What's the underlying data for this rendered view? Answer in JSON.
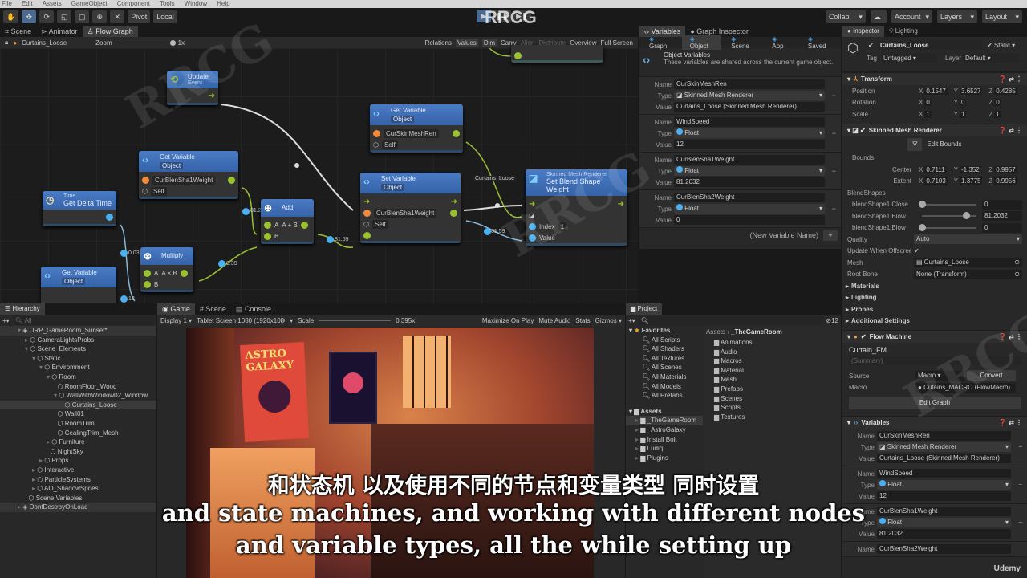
{
  "menu": [
    "File",
    "Edit",
    "Assets",
    "GameObject",
    "Component",
    "Tools",
    "Window",
    "Help"
  ],
  "toolbar": {
    "pivot": "Pivot",
    "local": "Local",
    "collab": "Collab",
    "account": "Account",
    "layers": "Layers",
    "layout": "Layout",
    "watermark": "RRCG"
  },
  "graph": {
    "tabs": [
      "Scene",
      "Animator",
      "Flow Graph"
    ],
    "object": "Curtains_Loose",
    "zoom_label": "Zoom",
    "zoom_value": "1x",
    "tools": [
      "Relations",
      "Values",
      "Dim",
      "Carry",
      "Align",
      "Distribute",
      "Overview",
      "Full Screen"
    ],
    "nodes": {
      "update": {
        "title": "Update",
        "sub": "Event"
      },
      "getvar1": {
        "title": "Get Variable",
        "kind": "Object",
        "var": "CurSkinMeshRen",
        "target": "Self"
      },
      "getvar2": {
        "title": "Get Variable",
        "kind": "Object",
        "var": "CurBlenSha1Weight",
        "target": "Self"
      },
      "time": {
        "sub": "Time",
        "title": "Get Delta Time"
      },
      "add": {
        "title": "Add",
        "a": "A",
        "op": "A + B",
        "b": "B"
      },
      "setvar": {
        "title": "Set Variable",
        "kind": "Object",
        "var": "CurBlenSha1Weight",
        "target": "Self"
      },
      "blend": {
        "sub": "Skinned Mesh Renderer",
        "title": "Set Blend Shape Weight",
        "index_label": "Index",
        "index": "1",
        "value_label": "Value"
      },
      "multiply": {
        "title": "Multiply",
        "a": "A",
        "op": "A × B",
        "b": "B"
      },
      "getvar3": {
        "title": "Get Variable",
        "kind": "Object"
      }
    },
    "wire_labels": {
      "v1": "81.2",
      "v2": "0.03",
      "v3": "0.39",
      "v4": "81.59",
      "v5": "81.59",
      "v6": "12",
      "obj": "Curtains_Loose"
    }
  },
  "variables": {
    "tabs": [
      "Variables",
      "Graph Inspector"
    ],
    "scopes": [
      "Graph",
      "Object",
      "Scene",
      "App",
      "Saved"
    ],
    "title": "Object Variables",
    "desc": "These variables are shared across the current game object.",
    "labels": {
      "name": "Name",
      "type": "Type",
      "value": "Value"
    },
    "items": [
      {
        "name": "CurSkinMeshRen",
        "type": "Skinned Mesh Renderer",
        "value": "Curtains_Loose (Skinned Mesh Renderer)"
      },
      {
        "name": "WindSpeed",
        "type": "Float",
        "value": "12"
      },
      {
        "name": "CurBlenSha1Weight",
        "type": "Float",
        "value": "81.2032"
      },
      {
        "name": "CurBlenSha2Weight",
        "type": "Float",
        "value": "0"
      }
    ],
    "new_placeholder": "(New Variable Name)"
  },
  "inspector": {
    "tabs": [
      "Inspector",
      "Lighting"
    ],
    "object": "Curtains_Loose",
    "static": "Static",
    "tag_label": "Tag",
    "tag": "Untagged",
    "layer_label": "Layer",
    "layer": "Default",
    "transform": {
      "title": "Transform",
      "rows": [
        {
          "label": "Position",
          "x": "0.1547",
          "y": "3.6527",
          "z": "0.4285"
        },
        {
          "label": "Rotation",
          "x": "0",
          "y": "0",
          "z": "0"
        },
        {
          "label": "Scale",
          "x": "1",
          "y": "1",
          "z": "1"
        }
      ]
    },
    "smr": {
      "title": "Skinned Mesh Renderer",
      "edit_bounds": "Edit Bounds",
      "bounds": "Bounds",
      "center": {
        "label": "Center",
        "x": "0.7111",
        "y": "-1.352",
        "z": "0.9957"
      },
      "extent": {
        "label": "Extent",
        "x": "0.7103",
        "y": "1.3775",
        "z": "0.9956"
      },
      "blendshapes": "BlendShapes",
      "shapes": [
        {
          "label": "blendShape1.Close",
          "value": "0",
          "pct": 0
        },
        {
          "label": "blendShape1.Blow",
          "value": "81.2032",
          "pct": 81.2
        },
        {
          "label": "blendShape1.Blow",
          "value": "0",
          "pct": 0
        }
      ],
      "quality_label": "Quality",
      "quality": "Auto",
      "offscreen_label": "Update When Offscreen",
      "mesh_label": "Mesh",
      "mesh": "Curtains_Loose",
      "rootbone_label": "Root Bone",
      "rootbone": "None (Transform)",
      "foldouts": [
        "Materials",
        "Lighting",
        "Probes",
        "Additional Settings"
      ]
    },
    "flow": {
      "title": "Flow Machine",
      "name": "Curtain_FM",
      "summary": "(Summary)",
      "source_label": "Source",
      "source": "Macro",
      "convert": "Convert",
      "macro_label": "Macro",
      "macro": "Cutains_MACRO (FlowMacro)",
      "edit": "Edit Graph"
    },
    "vars": {
      "title": "Variables",
      "items": [
        {
          "name": "CurSkinMeshRen",
          "type": "Skinned Mesh Renderer",
          "value": "Curtains_Loose (Skinned Mesh Renderer)"
        },
        {
          "name": "WindSpeed",
          "type": "Float",
          "value": "12"
        },
        {
          "name": "CurBlenSha1Weight",
          "type": "Float",
          "value": "81.2032"
        },
        {
          "name": "CurBlenSha2Weight"
        }
      ]
    }
  },
  "hierarchy": {
    "title": "Hierarchy",
    "search": "All",
    "items": [
      {
        "t": "URP_GameRoom_Sunset*",
        "d": 0
      },
      {
        "t": "CameraLightsProbs",
        "d": 1
      },
      {
        "t": "Scene_Elements",
        "d": 1
      },
      {
        "t": "Static",
        "d": 2
      },
      {
        "t": "Enviromment",
        "d": 3
      },
      {
        "t": "Room",
        "d": 4
      },
      {
        "t": "RoomFloor_Wood",
        "d": 5
      },
      {
        "t": "WallWithWindow02_Window",
        "d": 5
      },
      {
        "t": "Curtains_Loose",
        "d": 6
      },
      {
        "t": "Wall01",
        "d": 5
      },
      {
        "t": "RoomTrim",
        "d": 5
      },
      {
        "t": "CealingTrim_Mesh",
        "d": 5
      },
      {
        "t": "Furniture",
        "d": 4
      },
      {
        "t": "NightSky",
        "d": 4
      },
      {
        "t": "Props",
        "d": 3
      },
      {
        "t": "Interactive",
        "d": 2
      },
      {
        "t": "ParticleSystems",
        "d": 2
      },
      {
        "t": "AO_ShadowSpries",
        "d": 2
      },
      {
        "t": "Scene Variables",
        "d": 1
      },
      {
        "t": "DontDestroyOnLoad",
        "d": 0
      }
    ]
  },
  "game": {
    "tabs": [
      "Game",
      "Scene",
      "Console"
    ],
    "display": "Display 1",
    "resolution": "Tablet Screen 1080 (1920x1080)",
    "scale_label": "Scale",
    "scale": "0.395x",
    "maximize": "Maximize On Play",
    "mute": "Mute Audio",
    "stats": "Stats",
    "gizmos": "Gizmos",
    "poster": "ASTRO GALAXY"
  },
  "project": {
    "title": "Project",
    "count": "12",
    "favorites": "Favorites",
    "fav_items": [
      "All Scripts",
      "All Shaders",
      "All Textures",
      "All Scenes",
      "All Materials",
      "All Models",
      "All Prefabs"
    ],
    "assets": "Assets",
    "asset_items": [
      "_TheGameRoom",
      "_AstroGalaxy",
      "Install Bolt",
      "Ludiq",
      "Plugins"
    ],
    "breadcrumb": [
      "Assets",
      "_TheGameRoom"
    ],
    "folders": [
      "Animations",
      "Audio",
      "Macros",
      "Material",
      "Mesh",
      "Prefabs",
      "Scenes",
      "Scripts",
      "Textures"
    ]
  },
  "subtitles": {
    "zh": "和状态机 以及使用不同的节点和变量类型 同时设置",
    "en1": "and state machines, and working with different nodes",
    "en2": "and variable types, all the while setting up"
  },
  "brand": "Udemy"
}
